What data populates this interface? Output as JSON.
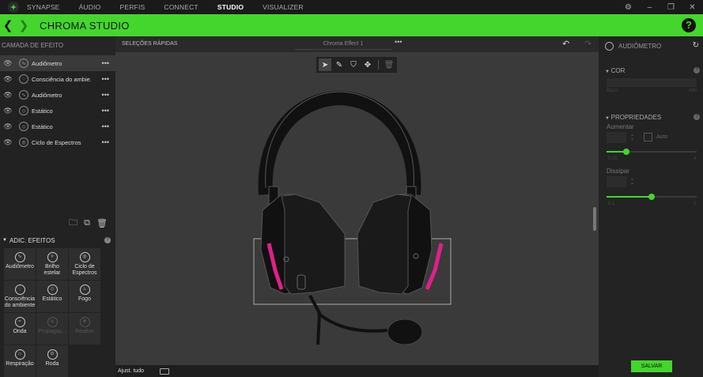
{
  "nav": {
    "items": [
      "SYNAPSE",
      "ÁUDIO",
      "PERFIS",
      "CONNECT",
      "STUDIO",
      "VISUALIZER"
    ],
    "active": "STUDIO"
  },
  "header": {
    "title": "CHROMA STUDIO",
    "help": "?"
  },
  "layers_panel": {
    "title": "CAMADA DE EFEITO",
    "layers": [
      {
        "label": "Audiômetro",
        "selected": true
      },
      {
        "label": "Consciência do ambie...",
        "selected": false
      },
      {
        "label": "Audiômetro",
        "selected": false
      },
      {
        "label": "Estático",
        "selected": false
      },
      {
        "label": "Estático",
        "selected": false
      },
      {
        "label": "Ciclo de Espectros",
        "selected": false
      }
    ],
    "more": "•••"
  },
  "add_effects": {
    "title": "ADIC. EFEITOS",
    "items": [
      {
        "label": "Audiômetro",
        "enabled": true,
        "icon": "audiometer-icon"
      },
      {
        "label": "Brilho estelar",
        "enabled": true,
        "icon": "starlight-icon"
      },
      {
        "label": "Ciclo de Espectros",
        "enabled": true,
        "icon": "spectrum-icon"
      },
      {
        "label": "Consciência do ambiente",
        "enabled": true,
        "icon": "ambient-icon"
      },
      {
        "label": "Estático",
        "enabled": true,
        "icon": "static-icon"
      },
      {
        "label": "Fogo",
        "enabled": true,
        "icon": "fire-icon"
      },
      {
        "label": "Onda",
        "enabled": true,
        "icon": "wave-icon"
      },
      {
        "label": "Propagaç...",
        "enabled": false,
        "icon": "ripple-icon"
      },
      {
        "label": "Reativo",
        "enabled": false,
        "icon": "reactive-icon"
      },
      {
        "label": "Respiração",
        "enabled": true,
        "icon": "breathing-icon"
      },
      {
        "label": "Roda",
        "enabled": true,
        "icon": "wheel-icon"
      }
    ]
  },
  "toolbar": {
    "quick_select": "SELEÇÕES RÁPIDAS",
    "effect_name": "Chroma Effect 1",
    "more": "•••"
  },
  "bottom": {
    "fit_all": "Ajust. tudo"
  },
  "props": {
    "title": "AUDIÔMETRO",
    "color_section": "COR",
    "color_low": "Baixo",
    "color_high": "Alto",
    "properties_section": "PROPRIEDADES",
    "increase_label": "Aumentar",
    "auto_label": "Auto",
    "increase_min": "0.05",
    "increase_max": "4",
    "increase_level": 0.22,
    "dissipate_label": "Dissipar",
    "dissipate_min": "0.1",
    "dissipate_max": "2",
    "dissipate_level": 0.5,
    "save": "SALVAR"
  },
  "colors": {
    "accent": "#44d62c",
    "highlight": "#e0208a"
  }
}
